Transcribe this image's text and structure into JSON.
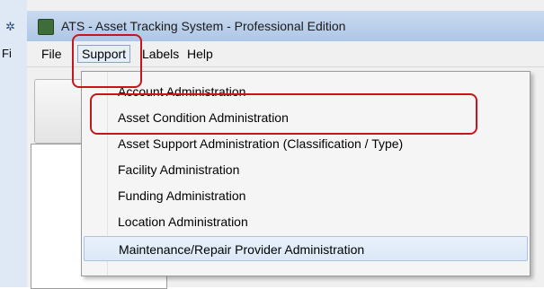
{
  "background_window": {
    "menu_fragment": "Fi"
  },
  "window": {
    "title": "ATS - Asset Tracking System - Professional Edition"
  },
  "menubar": {
    "items": [
      {
        "label": "File"
      },
      {
        "label": "Support"
      },
      {
        "label": "Labels"
      },
      {
        "label": "Help"
      }
    ]
  },
  "support_menu": {
    "items": [
      {
        "label": "Account Administration"
      },
      {
        "label": "Asset Condition Administration"
      },
      {
        "label": "Asset Support Administration (Classification / Type)"
      },
      {
        "label": "Facility Administration"
      },
      {
        "label": "Funding Administration"
      },
      {
        "label": "Location Administration"
      },
      {
        "label": "Maintenance/Repair Provider Administration"
      }
    ]
  },
  "colors": {
    "annotation": "#c4161c",
    "hover": "#dbe8f7"
  }
}
